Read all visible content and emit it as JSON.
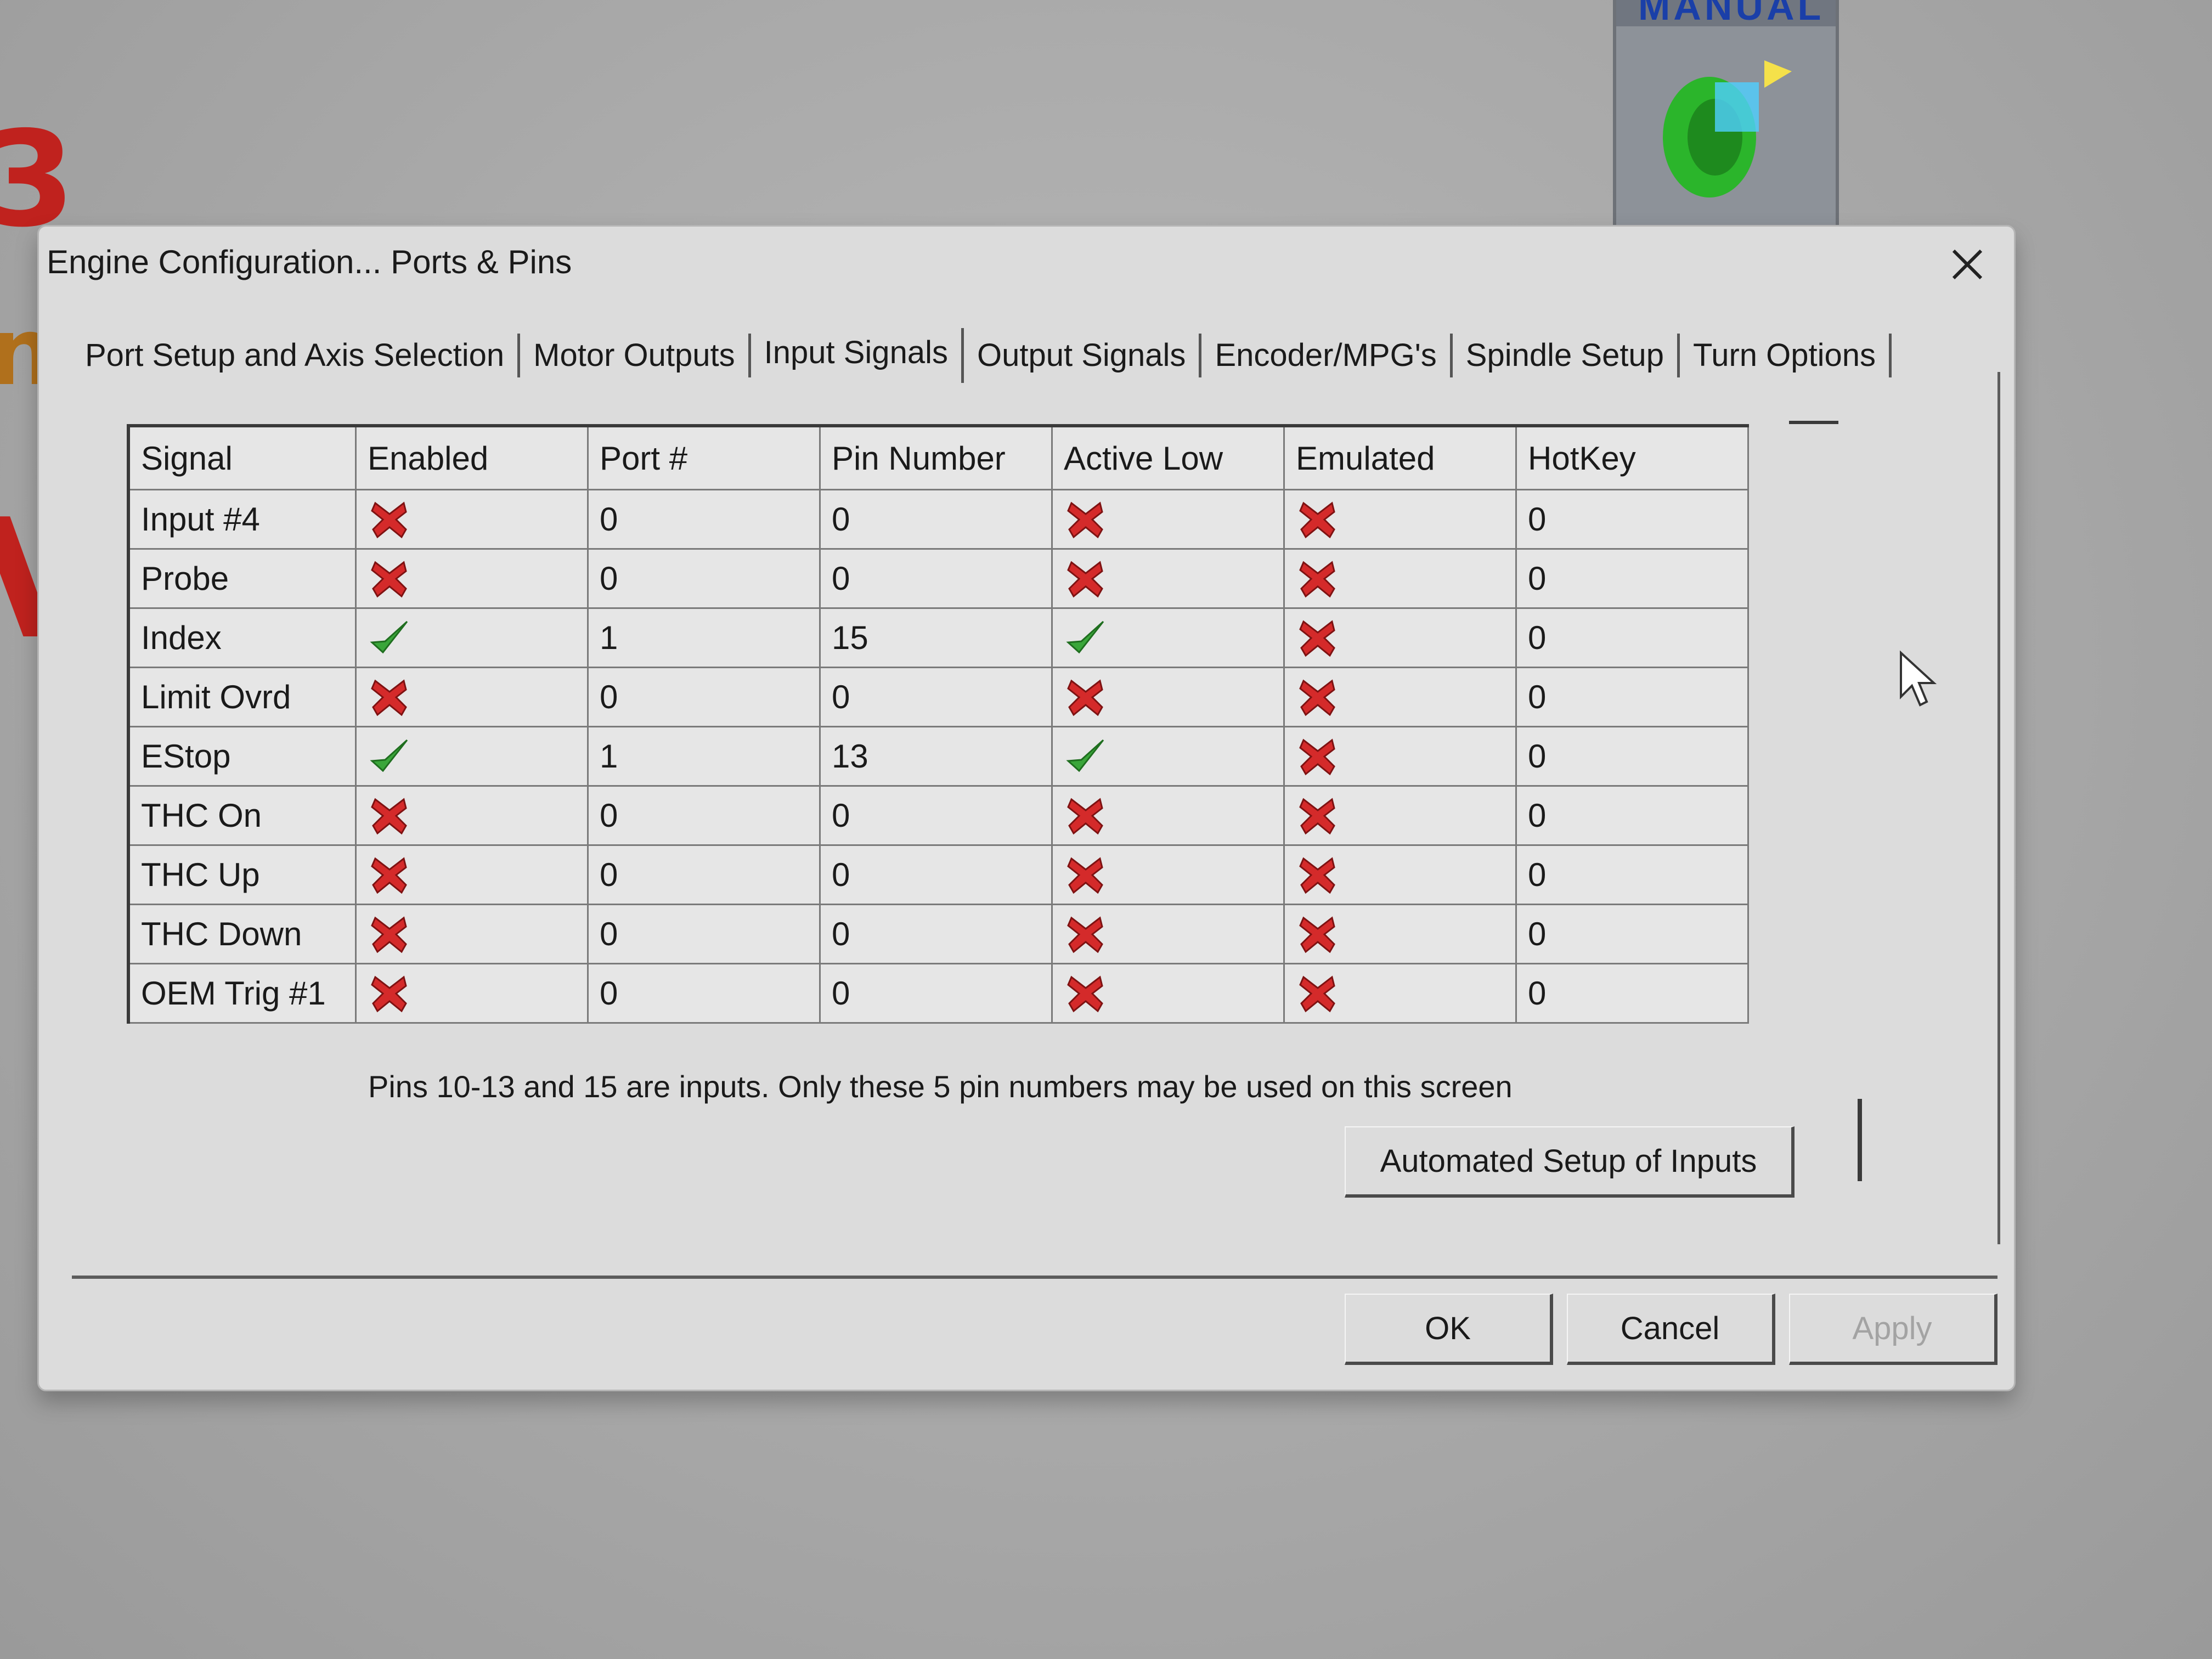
{
  "dialog": {
    "title": "Engine Configuration... Ports & Pins",
    "tabs": [
      {
        "label": "Port Setup and Axis Selection"
      },
      {
        "label": "Motor Outputs"
      },
      {
        "label": "Input Signals"
      },
      {
        "label": "Output Signals"
      },
      {
        "label": "Encoder/MPG's"
      },
      {
        "label": "Spindle Setup"
      },
      {
        "label": "Turn Options"
      }
    ],
    "active_tab": "Input Signals"
  },
  "grid": {
    "columns": [
      "Signal",
      "Enabled",
      "Port #",
      "Pin Number",
      "Active Low",
      "Emulated",
      "HotKey"
    ],
    "rows": [
      {
        "signal": "Input #4",
        "enabled": "no",
        "port": "0",
        "pin": "0",
        "active_low": "no",
        "emulated": "no",
        "hotkey": "0"
      },
      {
        "signal": "Probe",
        "enabled": "no",
        "port": "0",
        "pin": "0",
        "active_low": "no",
        "emulated": "no",
        "hotkey": "0"
      },
      {
        "signal": "Index",
        "enabled": "yes",
        "port": "1",
        "pin": "15",
        "active_low": "yes",
        "emulated": "no",
        "hotkey": "0"
      },
      {
        "signal": "Limit Ovrd",
        "enabled": "no",
        "port": "0",
        "pin": "0",
        "active_low": "no",
        "emulated": "no",
        "hotkey": "0"
      },
      {
        "signal": "EStop",
        "enabled": "yes",
        "port": "1",
        "pin": "13",
        "active_low": "yes",
        "emulated": "no",
        "hotkey": "0"
      },
      {
        "signal": "THC On",
        "enabled": "no",
        "port": "0",
        "pin": "0",
        "active_low": "no",
        "emulated": "no",
        "hotkey": "0"
      },
      {
        "signal": "THC Up",
        "enabled": "no",
        "port": "0",
        "pin": "0",
        "active_low": "no",
        "emulated": "no",
        "hotkey": "0"
      },
      {
        "signal": "THC Down",
        "enabled": "no",
        "port": "0",
        "pin": "0",
        "active_low": "no",
        "emulated": "no",
        "hotkey": "0"
      },
      {
        "signal": "OEM Trig #1",
        "enabled": "no",
        "port": "0",
        "pin": "0",
        "active_low": "no",
        "emulated": "no",
        "hotkey": "0"
      }
    ]
  },
  "note": "Pins 10-13 and 15 are inputs. Only these 5 pin numbers may be used on this screen",
  "buttons": {
    "automated": "Automated Setup of Inputs",
    "ok": "OK",
    "cancel": "Cancel",
    "apply": "Apply"
  },
  "icons": {
    "yes": "green-check-icon",
    "no": "red-x-icon",
    "colors": {
      "check": "#3aa63a",
      "x": "#d42a2a"
    }
  }
}
